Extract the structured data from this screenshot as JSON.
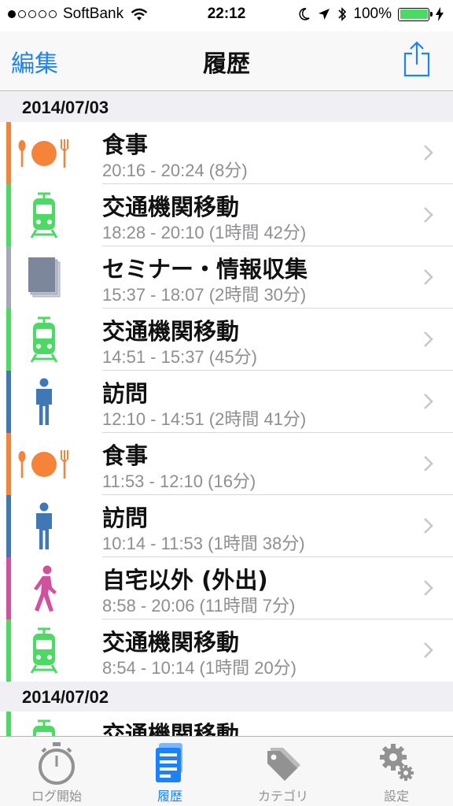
{
  "status_bar": {
    "carrier": "SoftBank",
    "time": "22:12",
    "battery": "100%"
  },
  "nav": {
    "edit_label": "編集",
    "title": "履歴"
  },
  "sections": [
    {
      "date": "2014/07/03",
      "items": [
        {
          "title": "食事",
          "time": "20:16 - 20:24 (8分)"
        },
        {
          "title": "交通機関移動",
          "time": "18:28 - 20:10 (1時間 42分)"
        },
        {
          "title": "セミナー・情報収集",
          "time": "15:37 - 18:07 (2時間 30分)"
        },
        {
          "title": "交通機関移動",
          "time": "14:51 - 15:37 (45分)"
        },
        {
          "title": "訪問",
          "time": "12:10 - 14:51 (2時間 41分)"
        },
        {
          "title": "食事",
          "time": "11:53 - 12:10 (16分)"
        },
        {
          "title": "訪問",
          "time": "10:14 - 11:53 (1時間 38分)"
        },
        {
          "title": "自宅以外 (外出)",
          "time": "8:58 - 20:06 (11時間 7分)"
        },
        {
          "title": "交通機関移動",
          "time": "8:54 - 10:14 (1時間 20分)"
        }
      ]
    },
    {
      "date": "2014/07/02",
      "items": [
        {
          "title": "交通機関移動",
          "time": ""
        }
      ]
    }
  ],
  "tabs": [
    {
      "label": "ログ開始"
    },
    {
      "label": "履歴"
    },
    {
      "label": "カテゴリ"
    },
    {
      "label": "設定"
    }
  ],
  "colors": {
    "accent": "#1a82fb",
    "meal": "#f5833a",
    "transit": "#4cd964",
    "seminar": "#a3a9b8",
    "visit": "#3f77b7",
    "outing": "#d2519c"
  },
  "icons": {
    "meal": "meal-icon",
    "transit": "train-icon",
    "seminar": "document-icon",
    "visit": "person-icon",
    "outing": "walking-person-icon"
  }
}
